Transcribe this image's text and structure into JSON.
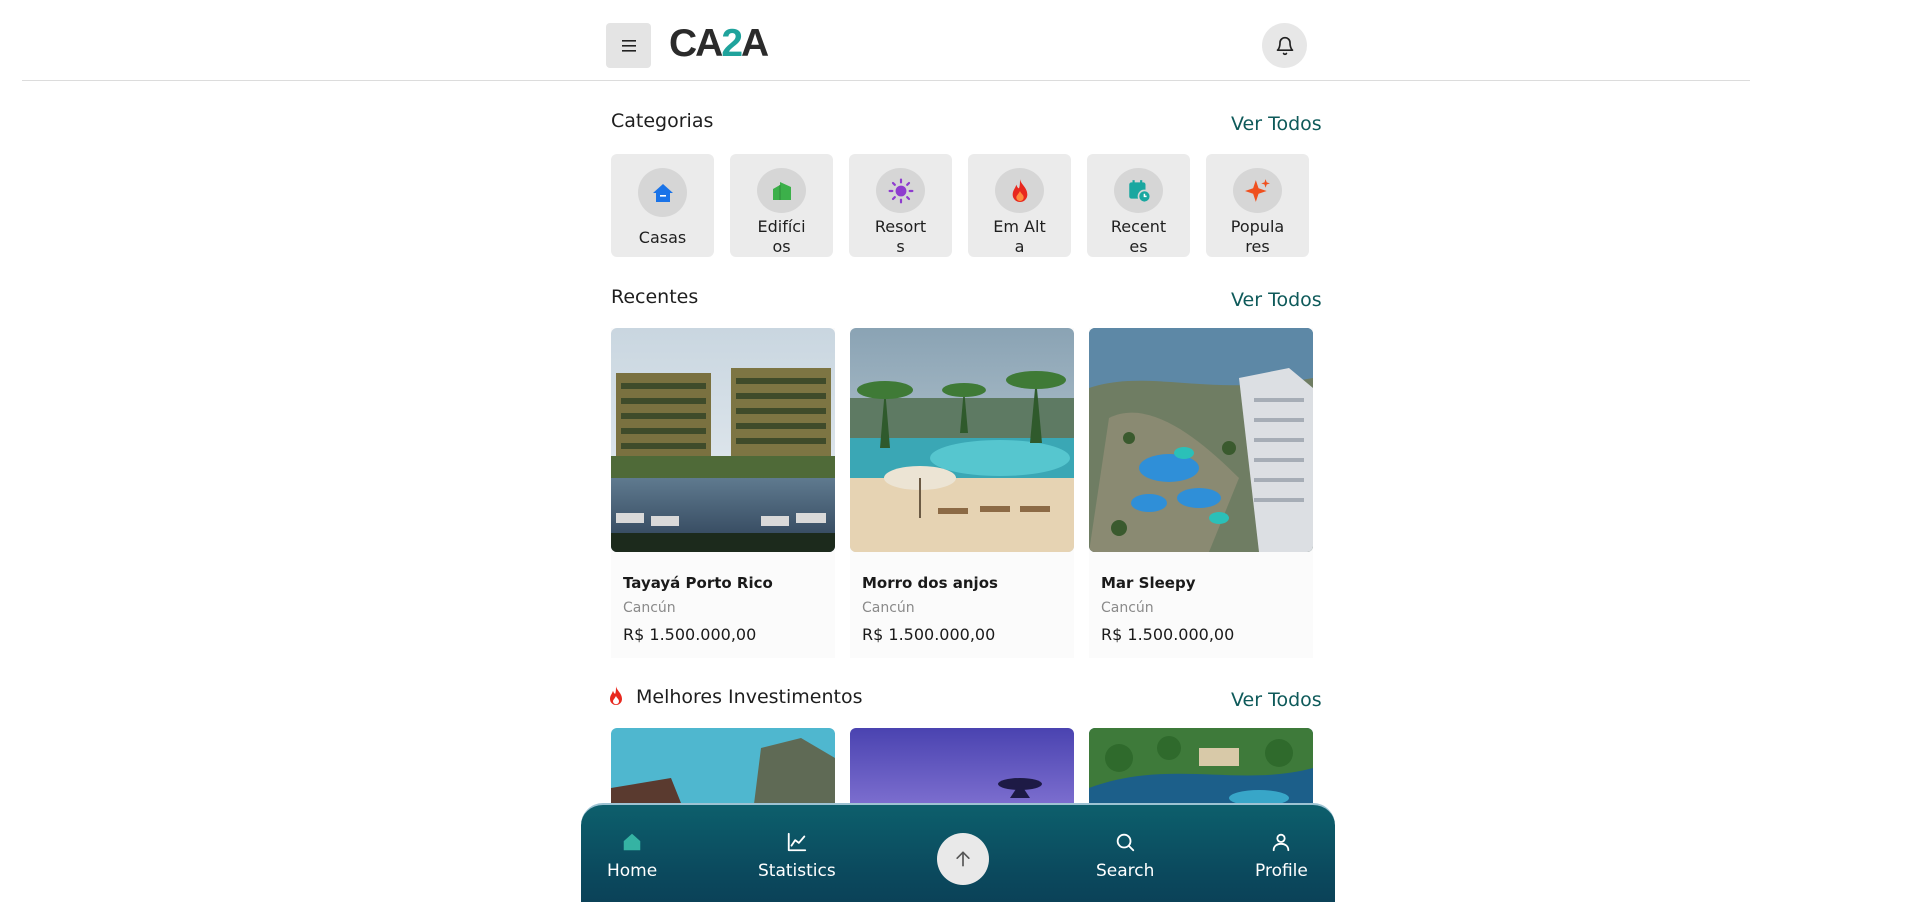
{
  "header": {
    "logo_text_a": "CA",
    "logo_text_b": "2",
    "logo_text_c": "A",
    "menu_icon": "hamburger-icon",
    "bell_icon": "bell-icon"
  },
  "categories": {
    "title": "Categorias",
    "see_all": "Ver Todos",
    "items": [
      {
        "label": "Casas",
        "icon": "house-icon",
        "color": "#1a73e8"
      },
      {
        "label": "Edifícios",
        "icon": "building-icon",
        "color": "#3cb04a"
      },
      {
        "label": "Resorts",
        "icon": "sun-icon",
        "color": "#8e3ccf"
      },
      {
        "label": "Em Alta",
        "icon": "flame-icon",
        "color": "#e8281e"
      },
      {
        "label": "Recentes",
        "icon": "calendar-clock-icon",
        "color": "#19a7a0"
      },
      {
        "label": "Populares",
        "icon": "sparkle-icon",
        "color": "#f0501e"
      }
    ]
  },
  "recentes": {
    "title": "Recentes",
    "see_all": "Ver Todos",
    "items": [
      {
        "name": "Tayayá Porto Rico",
        "location": "Cancún",
        "price": "R$ 1.500.000,00"
      },
      {
        "name": "Morro dos anjos",
        "location": "Cancún",
        "price": "R$ 1.500.000,00"
      },
      {
        "name": "Mar Sleepy",
        "location": "Cancún",
        "price": "R$ 1.500.000,00"
      }
    ]
  },
  "investimentos": {
    "title": "Melhores Investimentos",
    "see_all": "Ver Todos"
  },
  "bottom_nav": {
    "items": [
      {
        "label": "Home",
        "icon": "home-icon"
      },
      {
        "label": "Statistics",
        "icon": "chart-line-icon"
      },
      {
        "label": "Search",
        "icon": "search-icon"
      },
      {
        "label": "Profile",
        "icon": "user-icon"
      }
    ],
    "fab_icon": "arrow-up-icon",
    "accent": "#0d5f6c"
  }
}
